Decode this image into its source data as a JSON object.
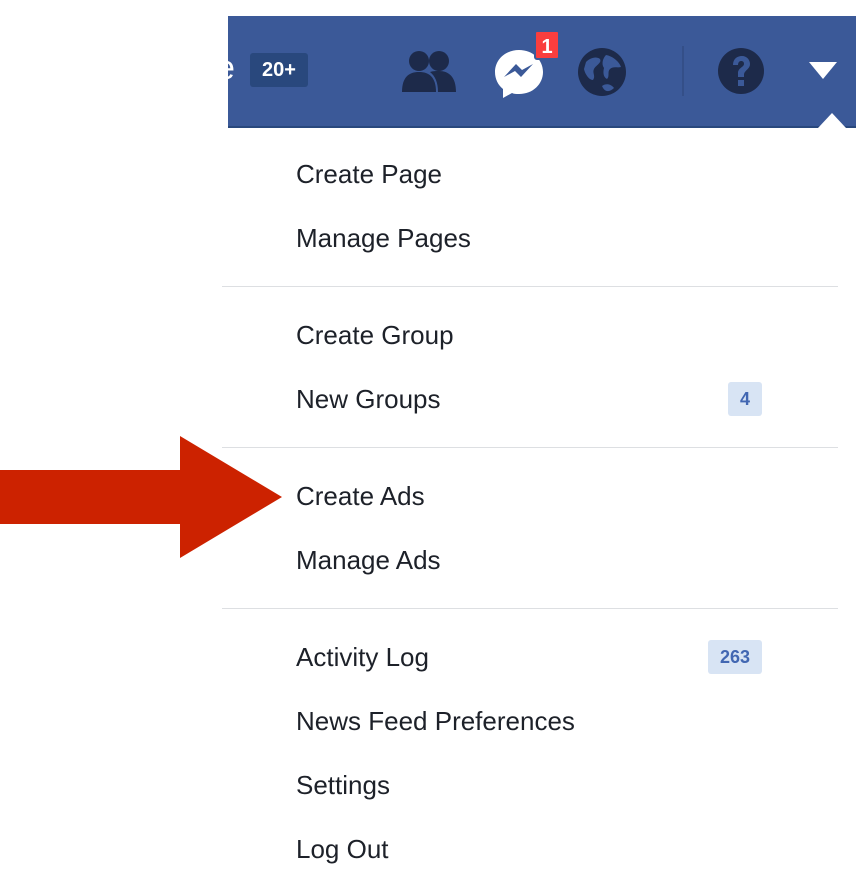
{
  "navbar": {
    "count_badge": "20+",
    "messenger_badge": "1",
    "icons": [
      "friends-icon",
      "messenger-icon",
      "globe-icon",
      "help-icon",
      "caret-down-icon"
    ]
  },
  "menu": {
    "groups": [
      [
        {
          "label": "Create Page"
        },
        {
          "label": "Manage Pages"
        }
      ],
      [
        {
          "label": "Create Group"
        },
        {
          "label": "New Groups",
          "badge": "4"
        }
      ],
      [
        {
          "label": "Create Ads"
        },
        {
          "label": "Manage Ads"
        }
      ],
      [
        {
          "label": "Activity Log",
          "badge": "263"
        },
        {
          "label": "News Feed Preferences"
        },
        {
          "label": "Settings"
        },
        {
          "label": "Log Out"
        }
      ]
    ]
  },
  "colors": {
    "nav_blue": "#3b5998",
    "nav_dark_blue": "#29487d",
    "notification_red": "#fa3e3e",
    "badge_bg": "#d8e4f4",
    "badge_text": "#4267b2",
    "arrow_red": "#cc2200",
    "divider": "#dddfe2"
  }
}
